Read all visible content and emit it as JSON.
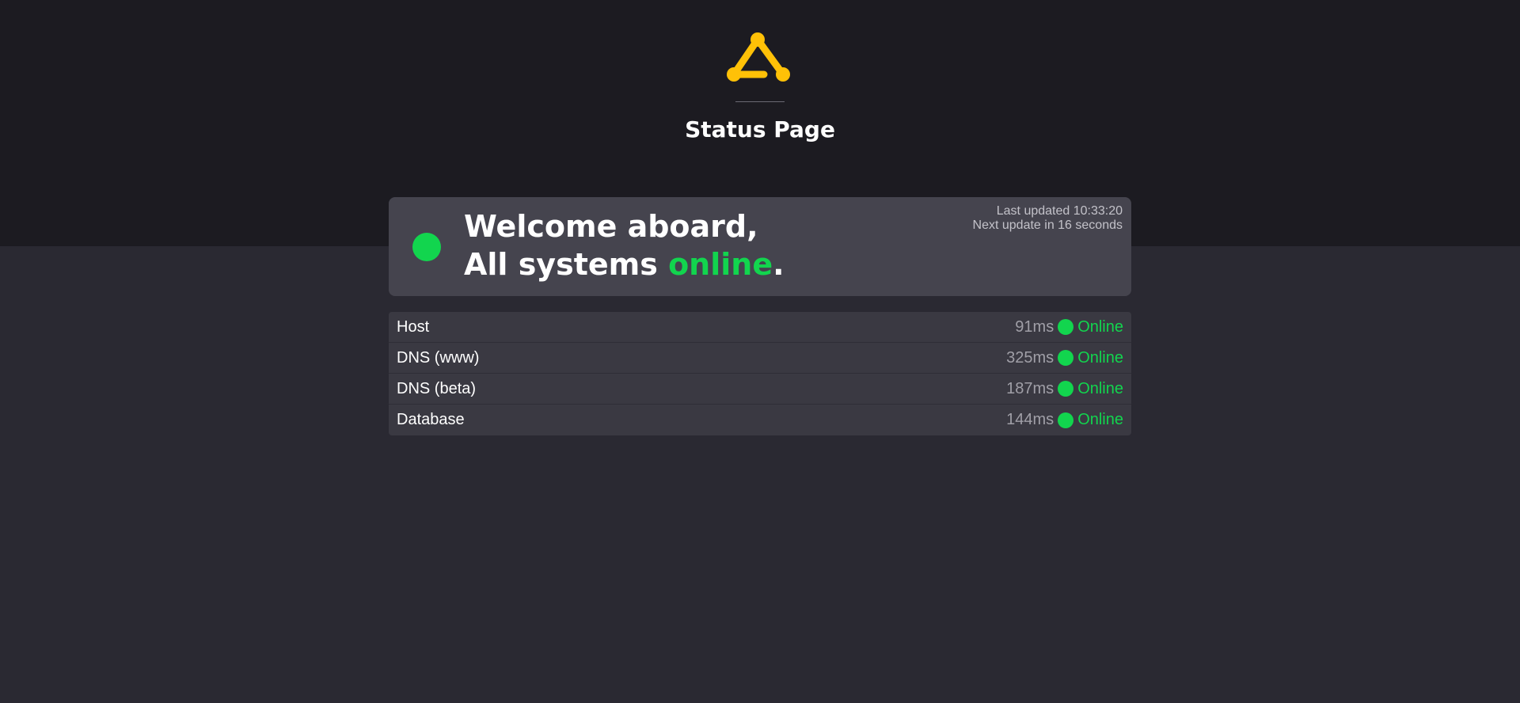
{
  "header": {
    "logo_icon": "triangle-nodes-logo",
    "logo_color": "#ffc107",
    "title": "Status Page"
  },
  "welcome": {
    "line1": "Welcome aboard,",
    "line2_prefix": "All systems ",
    "line2_status": "online",
    "line2_suffix": ".",
    "status_color": "#12d54e",
    "last_updated": "Last updated 10:33:20",
    "next_update": "Next update in 16 seconds"
  },
  "services": [
    {
      "name": "Host",
      "latency": "91ms",
      "status": "Online"
    },
    {
      "name": "DNS (www)",
      "latency": "325ms",
      "status": "Online"
    },
    {
      "name": "DNS (beta)",
      "latency": "187ms",
      "status": "Online"
    },
    {
      "name": "Database",
      "latency": "144ms",
      "status": "Online"
    }
  ]
}
